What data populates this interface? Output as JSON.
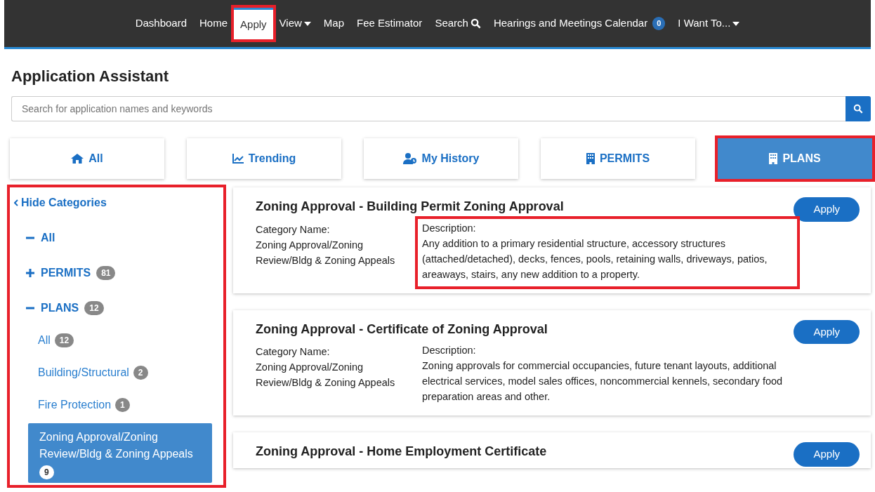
{
  "nav": {
    "items": [
      {
        "label": "Dashboard",
        "selected": false,
        "highlighted": false
      },
      {
        "label": "Home",
        "selected": false,
        "highlighted": false
      },
      {
        "label": "Apply",
        "selected": true,
        "highlighted": true
      },
      {
        "label": "View",
        "selected": false,
        "highlighted": false,
        "kind": "dropdown"
      },
      {
        "label": "Map",
        "selected": false,
        "highlighted": false
      },
      {
        "label": "Fee Estimator",
        "selected": false,
        "highlighted": false
      },
      {
        "label": "Search",
        "selected": false,
        "highlighted": false,
        "kind": "search"
      },
      {
        "label": "Hearings and Meetings Calendar",
        "selected": false,
        "highlighted": false,
        "kind": "badge",
        "badge": "0"
      },
      {
        "label": "I Want To...",
        "selected": false,
        "highlighted": false,
        "kind": "dropdown"
      }
    ]
  },
  "page_title": "Application Assistant",
  "search": {
    "placeholder": "Search for application names and keywords"
  },
  "tabs": [
    {
      "label": "All",
      "kind": "home",
      "selected": false,
      "highlighted": false
    },
    {
      "label": "Trending",
      "kind": "chart",
      "selected": false,
      "highlighted": false
    },
    {
      "label": "My History",
      "kind": "user",
      "selected": false,
      "highlighted": false
    },
    {
      "label": "PERMITS",
      "kind": "building",
      "selected": false,
      "highlighted": false
    },
    {
      "label": "PLANS",
      "kind": "building",
      "selected": true,
      "highlighted": true
    }
  ],
  "sidebar": {
    "highlighted": true,
    "toggle": "Hide Categories",
    "categories": [
      {
        "label": "All",
        "expanded": true
      },
      {
        "label": "PERMITS",
        "count": "81",
        "expanded": false
      },
      {
        "label": "PLANS",
        "count": "12",
        "expanded": true,
        "children": [
          {
            "label": "All",
            "count": "12",
            "selected": false
          },
          {
            "label": "Building/Structural",
            "count": "2",
            "selected": false
          },
          {
            "label": "Fire Protection",
            "count": "1",
            "selected": false
          },
          {
            "label": "Zoning Approval/Zoning Review/Bldg & Zoning Appeals",
            "count": "9",
            "selected": true
          }
        ]
      }
    ]
  },
  "results": [
    {
      "title": "Zoning Approval - Building Permit Zoning Approval",
      "button": "Apply",
      "category_label": "Category Name:",
      "category": "Zoning Approval/Zoning Review/Bldg & Zoning Appeals",
      "description_label": "Description:",
      "description": "Any addition to a primary residential structure, accessory structures (attached/detached), decks, fences, pools, retaining walls, driveways, patios, areaways, stairs, any new addition to a property.",
      "highlighted": true
    },
    {
      "title": "Zoning Approval - Certificate of Zoning Approval",
      "button": "Apply",
      "category_label": "Category Name:",
      "category": "Zoning Approval/Zoning Review/Bldg & Zoning Appeals",
      "description_label": "Description:",
      "description": "Zoning approvals for commercial occupancies, future tenant layouts, additional electrical services, model sales offices, noncommercial kennels, secondary food preparation areas and other.",
      "highlighted": false
    },
    {
      "title": "Zoning Approval - Home Employment Certificate",
      "button": "Apply"
    }
  ]
}
